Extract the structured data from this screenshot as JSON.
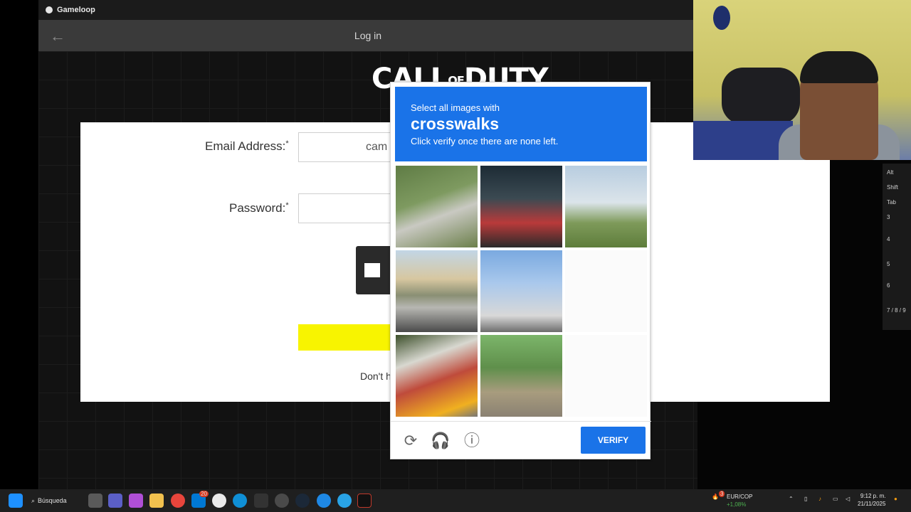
{
  "window": {
    "title": "Gameloop"
  },
  "login": {
    "header": "Log in",
    "email_label": "Email Address:",
    "email_value": "cam",
    "password_label": "Password:",
    "required_mark": "*",
    "dont_text": "Don't h"
  },
  "captcha": {
    "instruction": "Select all images with",
    "target": "crosswalks",
    "hint": "Click verify once there are none left.",
    "verify_label": "VERIFY",
    "tiles": [
      "image-1",
      "image-2",
      "image-3",
      "image-4",
      "image-5",
      "image-6",
      "image-7",
      "image-8",
      "image-9"
    ]
  },
  "keys": [
    "Alt",
    "Shift",
    "Tab",
    "3",
    "4",
    "5",
    "6",
    "7 / 8 / 9"
  ],
  "taskbar": {
    "search_label": "Búsqueda",
    "badge_count": "20",
    "ticker_name": "EUR/COP",
    "ticker_change": "+1,08%",
    "ticker_badge": "3",
    "time": "9:12 p. m.",
    "date": "21/11/2025"
  },
  "colors": {
    "accent": "#1a73e8",
    "yellow_button": "#f8f400",
    "taskbar": "#1f1f1f"
  }
}
